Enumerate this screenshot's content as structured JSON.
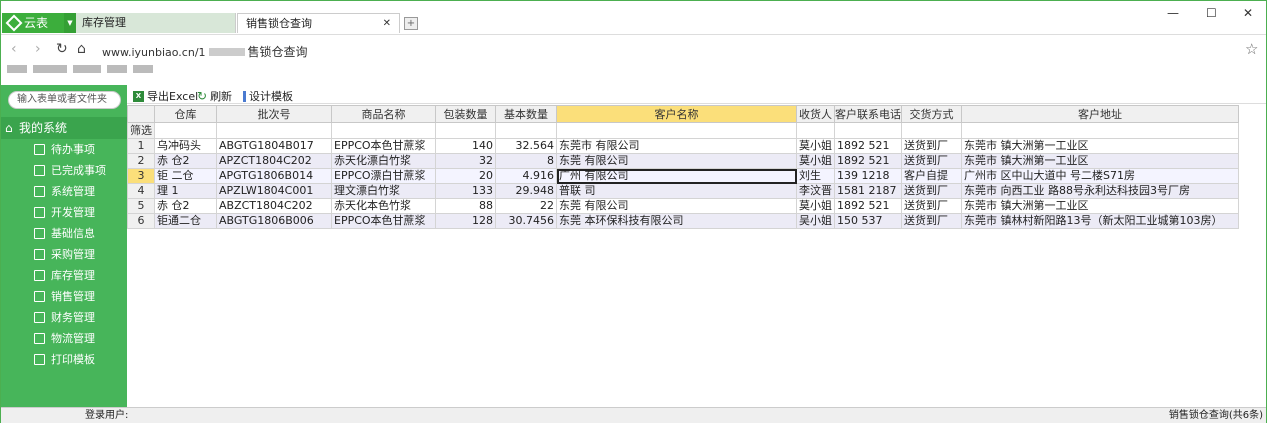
{
  "tabs": {
    "brand": "云表",
    "tab1": "库存管理",
    "tab2": "销售锁仓查询"
  },
  "address": {
    "url": "www.iyunbiao.cn/1",
    "page_title": "售锁仓查询"
  },
  "sidebar": {
    "search_placeholder": "输入表单或者文件夹",
    "root": "我的系统",
    "items": [
      {
        "label": "待办事项"
      },
      {
        "label": "已完成事项"
      },
      {
        "label": "系统管理"
      },
      {
        "label": "开发管理"
      },
      {
        "label": "基础信息"
      },
      {
        "label": "采购管理"
      },
      {
        "label": "库存管理"
      },
      {
        "label": "销售管理"
      },
      {
        "label": "财务管理"
      },
      {
        "label": "物流管理"
      },
      {
        "label": "打印模板"
      }
    ]
  },
  "toolbar": {
    "export": "导出Excel",
    "refresh": "刷新",
    "design": "设计模板"
  },
  "grid": {
    "filter_label": "筛选",
    "columns": [
      "仓库",
      "批次号",
      "商品名称",
      "包装数量",
      "基本数量",
      "客户名称",
      "收货人",
      "客户联系电话",
      "交货方式",
      "客户地址"
    ],
    "rows": [
      [
        "1",
        "乌冲码头",
        "ABGTG1804B017",
        "EPPCO本色甘蔗浆",
        "140",
        "32.564",
        "东莞市 有限公司",
        "莫小姐",
        "1892 521",
        "送货到厂",
        "东莞市 镇大洲第一工业区"
      ],
      [
        "2",
        "赤 仓2",
        "APZCT1804C202",
        "赤天化漂白竹浆",
        "32",
        "8",
        "东莞 有限公司",
        "莫小姐",
        "1892 521",
        "送货到厂",
        "东莞市 镇大洲第一工业区"
      ],
      [
        "3",
        "钜 二仓",
        "APGTG1806B014",
        "EPPCO漂白甘蔗浆",
        "20",
        "4.916",
        "广州 有限公司",
        "刘生",
        "139 1218",
        "客户自提",
        "广州市 区中山大道中 号二楼S71房"
      ],
      [
        "4",
        "理 1",
        "APZLW1804C001",
        "理文漂白竹浆",
        "133",
        "29.948",
        "普联 司",
        "李汶晋",
        "1581 2187",
        "送货到厂",
        "东莞市 向西工业 路88号永利达科技园3号厂房"
      ],
      [
        "5",
        "赤 仓2",
        "ABZCT1804C202",
        "赤天化本色竹浆",
        "88",
        "22",
        "东莞 有限公司",
        "莫小姐",
        "1892 521",
        "送货到厂",
        "东莞市 镇大洲第一工业区"
      ],
      [
        "6",
        "钜通二仓",
        "ABGTG1806B006",
        "EPPCO本色甘蔗浆",
        "128",
        "30.7456",
        "东莞 本环保科技有限公司",
        "吴小姐",
        "150 537",
        "送货到厂",
        "东莞市 镇林村新阳路13号（新太阳工业城第103房）"
      ]
    ]
  },
  "status": {
    "left": "登录用户:",
    "right": "销售锁仓查询(共6条)"
  },
  "colors": {
    "sidebar": "#47b55a",
    "header_highlight": "#fbdf7a",
    "row_stripe": "#ecebf6"
  }
}
